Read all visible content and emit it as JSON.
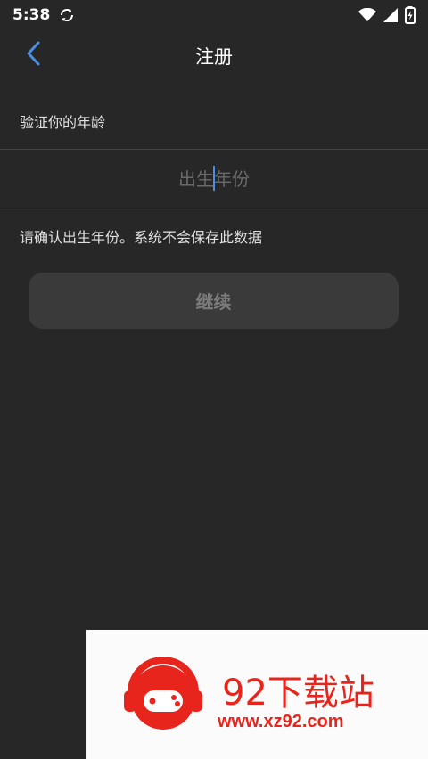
{
  "status_bar": {
    "time": "5:38",
    "icons": [
      "sync-icon",
      "wifi-icon",
      "signal-icon",
      "battery-charging-icon"
    ]
  },
  "header": {
    "title": "注册",
    "back_icon": "chevron-left-icon"
  },
  "form": {
    "section_label": "验证你的年龄",
    "year_input": {
      "value": "",
      "placeholder": "出生年份"
    },
    "hint": "请确认出生年份。系统不会保存此数据",
    "continue_label": "继续"
  },
  "colors": {
    "background": "#272727",
    "accent": "#4a8fe0",
    "button_disabled": "#3a3a3a",
    "watermark_red": "#e8251c"
  },
  "watermark": {
    "title": "92下载站",
    "url": "www.xz92.com"
  }
}
